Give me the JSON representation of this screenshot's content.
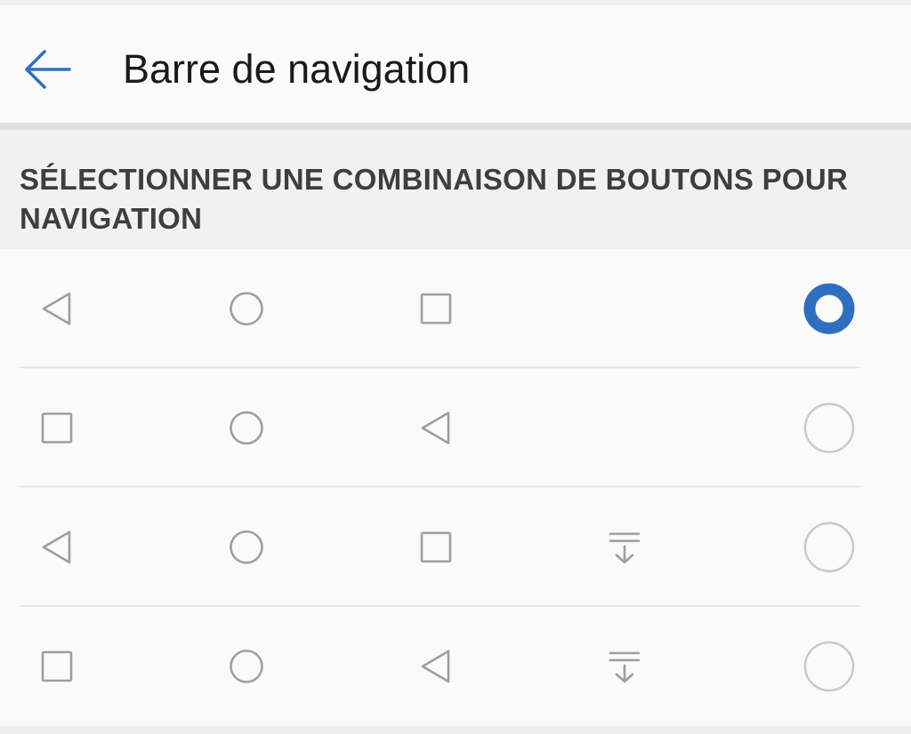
{
  "header": {
    "title": "Barre de navigation",
    "back_icon": "arrow-left-icon",
    "accent_color": "#2f6fc0"
  },
  "section": {
    "title": "SÉLECTIONNER UNE COMBINAISON DE BOUTONS POUR NAVIGATION"
  },
  "options": [
    {
      "buttons": [
        "back-triangle-icon",
        "home-circle-icon",
        "recents-square-icon"
      ],
      "selected": true
    },
    {
      "buttons": [
        "recents-square-icon",
        "home-circle-icon",
        "back-triangle-icon"
      ],
      "selected": false
    },
    {
      "buttons": [
        "back-triangle-icon",
        "home-circle-icon",
        "recents-square-icon",
        "notification-pull-down-icon"
      ],
      "selected": false
    },
    {
      "buttons": [
        "recents-square-icon",
        "home-circle-icon",
        "back-triangle-icon",
        "notification-pull-down-icon"
      ],
      "selected": false
    }
  ],
  "colors": {
    "icon": "#9e9e9e",
    "radio_unselected": "#c8c8c8",
    "radio_selected": "#2f6fc0"
  }
}
